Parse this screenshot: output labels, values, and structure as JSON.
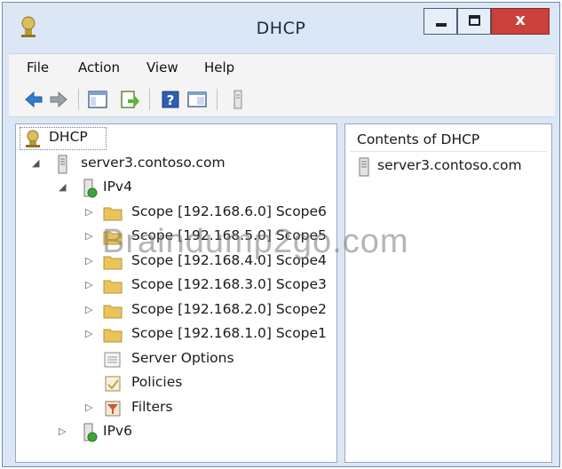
{
  "window": {
    "title": "DHCP",
    "close_glyph": "x",
    "icons": [
      "dhcp-icon",
      "minimize-icon",
      "maximize-icon",
      "close-icon"
    ]
  },
  "menu": {
    "items": [
      {
        "label": "File"
      },
      {
        "label": "Action"
      },
      {
        "label": "View"
      },
      {
        "label": "Help"
      }
    ]
  },
  "toolbar": {
    "buttons": [
      "back-icon",
      "forward-icon",
      "show-hide-tree-icon",
      "export-list-icon",
      "help-icon",
      "properties-icon",
      "server-icon"
    ]
  },
  "tree": {
    "root": {
      "label": "DHCP",
      "icon": "dhcp-icon"
    },
    "server": {
      "label": "server3.contoso.com",
      "icon": "server-icon",
      "expanded": true
    },
    "ipv4": {
      "label": "IPv4",
      "icon": "ipv4-icon",
      "expanded": true
    },
    "scopes": [
      {
        "label": "Scope [192.168.6.0] Scope6"
      },
      {
        "label": "Scope [192.168.5.0] Scope5"
      },
      {
        "label": "Scope [192.168.4.0] Scope4"
      },
      {
        "label": "Scope [192.168.3.0] Scope3"
      },
      {
        "label": "Scope [192.168.2.0] Scope2"
      },
      {
        "label": "Scope [192.168.1.0] Scope1"
      }
    ],
    "server_options": {
      "label": "Server Options",
      "icon": "server-options-icon"
    },
    "policies": {
      "label": "Policies",
      "icon": "policies-icon"
    },
    "filters": {
      "label": "Filters",
      "icon": "filters-icon"
    },
    "ipv6": {
      "label": "IPv6",
      "icon": "ipv6-icon",
      "expanded": false
    }
  },
  "contents": {
    "header": "Contents of DHCP",
    "items": [
      {
        "label": "server3.contoso.com",
        "icon": "server-icon"
      }
    ]
  },
  "watermark": "Braindump2go.com",
  "colors": {
    "window_frame": "#dbe7f4",
    "close_button": "#c9413a",
    "folder": "#e8c45a"
  }
}
